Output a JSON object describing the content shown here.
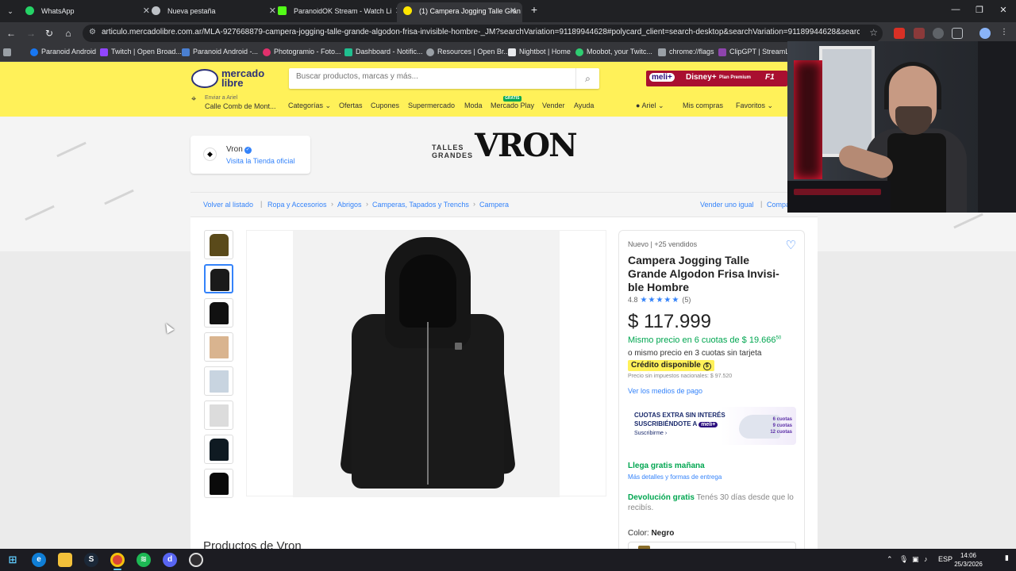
{
  "browser": {
    "tabs": [
      {
        "title": "WhatsApp",
        "color": "#25d366"
      },
      {
        "title": "Nueva pestaña",
        "color": "#bdc1c6"
      },
      {
        "title": "ParanoidOK Stream - Watch Li",
        "color": "#53fc18"
      },
      {
        "title": "(1) Campera Jogging Talle Gran",
        "color": "#ffe600"
      }
    ],
    "url": "articulo.mercadolibre.com.ar/MLA-927668879-campera-jogging-talle-grande-algodon-frisa-invisible-hombre-_JM?searchVariation=91189944628#polycard_client=search-desktop&searchVariation=91189944628&search_layout=gri...",
    "bookmarks": [
      {
        "label": "Paranoid Android",
        "color": "#1877f2"
      },
      {
        "label": "Twitch | Open Broad...",
        "color": "#9146ff"
      },
      {
        "label": "Paranoid Android -...",
        "color": "#4a7fd1"
      },
      {
        "label": "Photogramio - Foto...",
        "color": "#e1306c"
      },
      {
        "label": "Dashboard - Notific...",
        "color": "#1fbf8f"
      },
      {
        "label": "Resources | Open Br...",
        "color": "#9aa0a6"
      },
      {
        "label": "Nightbot | Home",
        "color": "#e8eaed"
      },
      {
        "label": "Moobot, your Twitc...",
        "color": "#2ecc71"
      },
      {
        "label": "chrome://flags",
        "color": "#9aa0a6"
      },
      {
        "label": "ClipGPT | StreamLad...",
        "color": "#8e44ad"
      }
    ]
  },
  "ml": {
    "logo_line1": "mercado",
    "logo_line2": "libre",
    "search_placeholder": "Buscar productos, marcas y más...",
    "promo_items": [
      "meli+",
      "Disney+",
      "Plan Premium",
      "F1"
    ],
    "deliver_label": "Enviar a Ariel",
    "deliver_address": "Calle Comb de Mont...",
    "nav": [
      "Categorías ⌄",
      "Ofertas",
      "Cupones",
      "Supermercado",
      "Moda",
      "Mercado Play",
      "Vender",
      "Ayuda"
    ],
    "nav_badge": "GRATIS",
    "user": "Ariel ⌄",
    "mis_compras": "Mis compras",
    "favoritos": "Favoritos ⌄"
  },
  "store": {
    "name": "Vron",
    "link": "Visita la Tienda oficial",
    "brand_small": "TALLES\nGRANDES",
    "brand_big": "VRON"
  },
  "breadcrumb": {
    "back": "Volver al listado",
    "crumbs": [
      "Ropa y Accesorios",
      "Abrigos",
      "Camperas, Tapados y Trenchs",
      "Campera"
    ],
    "sell": "Vender uno igual",
    "share": "Compartir"
  },
  "product": {
    "condition": "Nuevo  |  +25 vendidos",
    "title": "Campera Jogging Talle Grande Algodon Frisa Invisi-ble Hombre",
    "rating": "4.8",
    "rating_stars": 4.8,
    "reviews": "(5)",
    "price": "$ 117.999",
    "cuotas_main": "Mismo precio en 6 cuotas de $ 19.666",
    "cuotas_cents": "50",
    "cuotas_alt": "o mismo precio en 3 cuotas sin tarjeta",
    "credito": "Crédito disponible",
    "sin_impuestos": "Precio sin impuestos nacionales: $ 97.520",
    "medios_pago": "Ver los medios de pago",
    "promo_l1": "CUOTAS EXTRA SIN INTERÉS",
    "promo_l2": "SUSCRIBIÉNDOTE A",
    "promo_badge": "meli+",
    "promo_cta": "Suscribirme ›",
    "promo_cuotas": "6 cuotas\n9 cuotas\n12 cuotas",
    "ship": "Llega gratis mañana",
    "ship_more": "Más detalles y formas de entrega",
    "return_bold": "Devolución gratis",
    "return_text": " Tenés 30 días desde que lo recibís.",
    "color_label": "Color: ",
    "color_value": "Negro",
    "more_title": "Productos de Vron"
  },
  "taskbar": {
    "apps": [
      "Start",
      "Edge",
      "Explorer",
      "Steam",
      "Chrome",
      "Spotify",
      "Discord",
      "OBS"
    ],
    "lang": "ESP",
    "time": "14:06",
    "date": "25/3/2026"
  }
}
